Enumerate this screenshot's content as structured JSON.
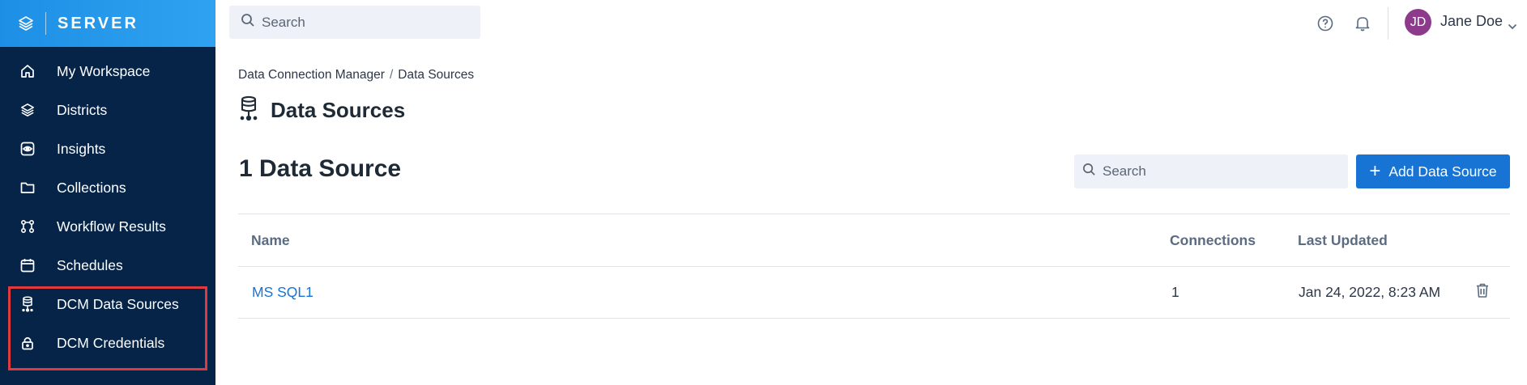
{
  "brand": {
    "name": "SERVER",
    "icon": "layers-icon"
  },
  "sidebar": {
    "items": [
      {
        "label": "My Workspace",
        "icon": "home-icon"
      },
      {
        "label": "Districts",
        "icon": "layers-icon"
      },
      {
        "label": "Insights",
        "icon": "eye-icon"
      },
      {
        "label": "Collections",
        "icon": "folder-icon"
      },
      {
        "label": "Workflow Results",
        "icon": "workflow-icon"
      },
      {
        "label": "Schedules",
        "icon": "calendar-icon"
      },
      {
        "label": "DCM Data Sources",
        "icon": "database-icon"
      },
      {
        "label": "DCM Credentials",
        "icon": "lock-icon"
      }
    ]
  },
  "topbar": {
    "search_placeholder": "Search",
    "user": {
      "initials": "JD",
      "name": "Jane Doe"
    },
    "avatar_color": "#8d3a8c"
  },
  "breadcrumb": {
    "parent": "Data Connection Manager",
    "separator": "/",
    "current": "Data Sources"
  },
  "page": {
    "title": "Data Sources",
    "count_title": "1 Data Source",
    "search_placeholder": "Search",
    "add_button": "Add Data Source"
  },
  "table": {
    "columns": {
      "name": "Name",
      "connections": "Connections",
      "last_updated": "Last Updated"
    },
    "rows": [
      {
        "name": "MS SQL1",
        "connections": "1",
        "last_updated": "Jan 24, 2022, 8:23 AM"
      }
    ]
  },
  "colors": {
    "sidebar_bg": "#062447",
    "brand_bg": "#1d8fe6",
    "accent": "#1773d4",
    "highlight": "#e0393e"
  }
}
